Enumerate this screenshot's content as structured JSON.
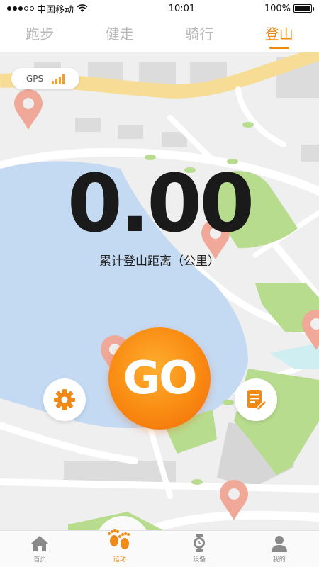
{
  "status_bar": {
    "carrier": "中国移动",
    "time": "10:01",
    "battery": "100%",
    "battery_level": 1.0
  },
  "tabs": [
    {
      "label": "跑步",
      "active": false
    },
    {
      "label": "健走",
      "active": false
    },
    {
      "label": "骑行",
      "active": false
    },
    {
      "label": "登山",
      "active": true
    }
  ],
  "gps": {
    "label": "GPS",
    "signal_bars": 4
  },
  "distance": {
    "value": "0.00",
    "label": "累计登山距离（公里）"
  },
  "go_button": {
    "label": "GO"
  },
  "icons": {
    "settings": "gear-icon",
    "record": "edit-note-icon"
  },
  "colors": {
    "accent": "#f08a14",
    "water": "#c4d9f2",
    "park": "#b8dc8e",
    "road_major": "#f7dc96",
    "pin": "#f0a898"
  },
  "bottom_nav": [
    {
      "label": "首页",
      "icon": "home-icon",
      "active": false
    },
    {
      "label": "运动",
      "icon": "footprints-icon",
      "active": true
    },
    {
      "label": "设备",
      "icon": "watch-icon",
      "active": false
    },
    {
      "label": "我的",
      "icon": "user-icon",
      "active": false
    }
  ]
}
